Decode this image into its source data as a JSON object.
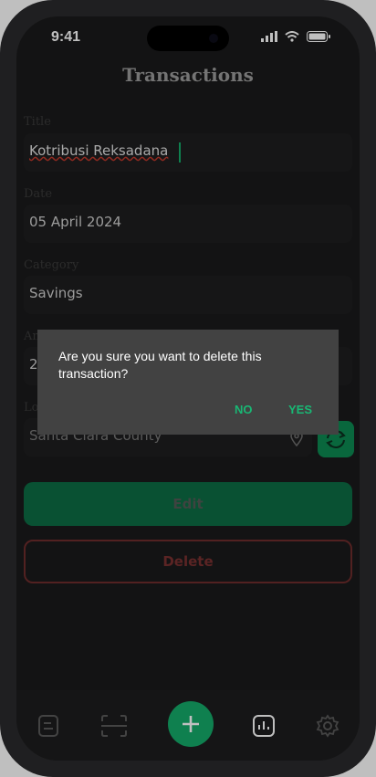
{
  "status_bar": {
    "time": "9:41"
  },
  "header": {
    "title": "Transactions"
  },
  "form": {
    "title": {
      "label": "Title",
      "value": "Kotribusi Reksadana"
    },
    "date": {
      "label": "Date",
      "value": "05 April 2024"
    },
    "category": {
      "label": "Category",
      "value": "Savings"
    },
    "amount": {
      "label": "Amount",
      "value": "2"
    },
    "location": {
      "label": "Location",
      "value": "Santa Clara County"
    }
  },
  "buttons": {
    "edit": "Edit",
    "delete": "Delete"
  },
  "dialog": {
    "message": "Are you sure you want to delete this transaction?",
    "no": "NO",
    "yes": "YES"
  },
  "nav": {
    "items": [
      "transactions-icon",
      "scan-icon",
      "add-icon",
      "chart-icon",
      "gear-icon"
    ],
    "active": "chart-icon"
  },
  "colors": {
    "accent": "#14ab6a",
    "danger": "#7a3030",
    "dialog_bg": "#424242"
  }
}
